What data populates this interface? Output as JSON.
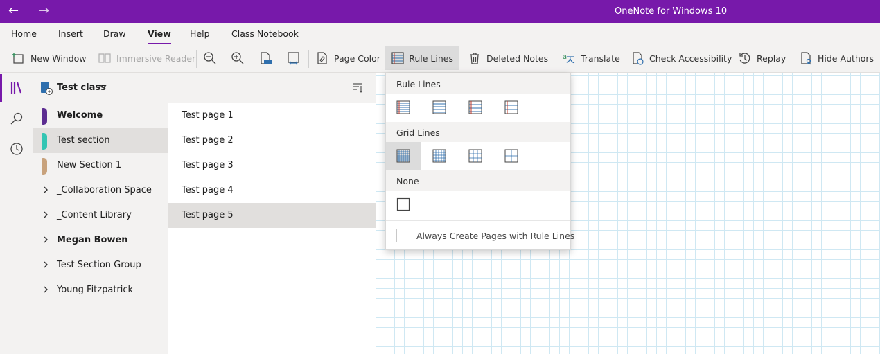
{
  "titlebar": {
    "title": "OneNote for Windows 10",
    "back_icon": "arrow-left-icon",
    "forward_icon": "arrow-right-icon"
  },
  "ribbon": {
    "tabs": [
      "Home",
      "Insert",
      "Draw",
      "View",
      "Help",
      "Class Notebook"
    ],
    "active_tab": "View",
    "toolbar": {
      "new_window": "New Window",
      "immersive_reader": "Immersive Reader",
      "page_color": "Page Color",
      "rule_lines": "Rule Lines",
      "deleted_notes": "Deleted Notes",
      "translate": "Translate",
      "check_accessibility": "Check Accessibility",
      "replay": "Replay",
      "hide_authors": "Hide Authors"
    }
  },
  "notebook": {
    "name": "Test class"
  },
  "sections": [
    {
      "label": "Welcome",
      "color": "#5c2d91",
      "bold": true
    },
    {
      "label": "Test section",
      "color": "#33c5b3",
      "selected": true
    },
    {
      "label": "New Section 1",
      "color": "#c8a27c"
    },
    {
      "label": "_Collaboration Space",
      "group": true
    },
    {
      "label": "_Content Library",
      "group": true
    },
    {
      "label": "Megan Bowen",
      "group": true,
      "bold": true
    },
    {
      "label": "Test Section Group",
      "group": true
    },
    {
      "label": "Young Fitzpatrick",
      "group": true
    }
  ],
  "pages": [
    {
      "label": "Test page 1"
    },
    {
      "label": "Test page 2"
    },
    {
      "label": "Test page 3"
    },
    {
      "label": "Test page 4"
    },
    {
      "label": "Test page 5",
      "selected": true
    }
  ],
  "rule_lines_menu": {
    "rule_lines_header": "Rule Lines",
    "grid_lines_header": "Grid Lines",
    "none_header": "None",
    "always_create": "Always Create Pages with Rule Lines",
    "always_create_checked": false,
    "selected_option": "grid-lines-1"
  },
  "colors": {
    "accent": "#7719aa",
    "grid": "#cfe8f3",
    "icon_blue": "#2f6fad",
    "icon_red": "#c0392b"
  }
}
